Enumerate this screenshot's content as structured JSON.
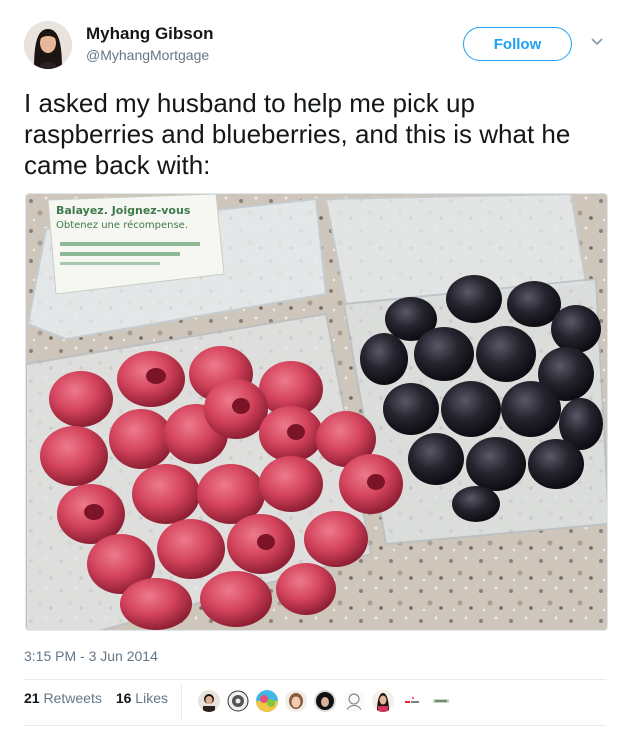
{
  "user": {
    "name": "Myhang Gibson",
    "handle": "@MyhangMortgage"
  },
  "follow_label": "Follow",
  "tweet": {
    "text": "I asked my husband to help me pick up raspberries and blueberries, and this is what he came back with:"
  },
  "photo": {
    "label_lines": [
      "Balayez. Joignez-vous",
      "Obtenez une récompense."
    ]
  },
  "timestamp": "3:15 PM - 3 Jun 2014",
  "stats": {
    "retweets_count": "21",
    "retweets_label": "Retweets",
    "likes_count": "16",
    "likes_label": "Likes"
  },
  "likers": [
    "avatar-1",
    "avatar-2",
    "avatar-3",
    "avatar-4",
    "avatar-5",
    "avatar-6",
    "avatar-7",
    "avatar-8",
    "avatar-9"
  ],
  "colors": {
    "accent": "#1da1f2",
    "text": "#14171a",
    "muted": "#657786",
    "raspberry": "#c8344f",
    "blackberry": "#1c1b24"
  }
}
